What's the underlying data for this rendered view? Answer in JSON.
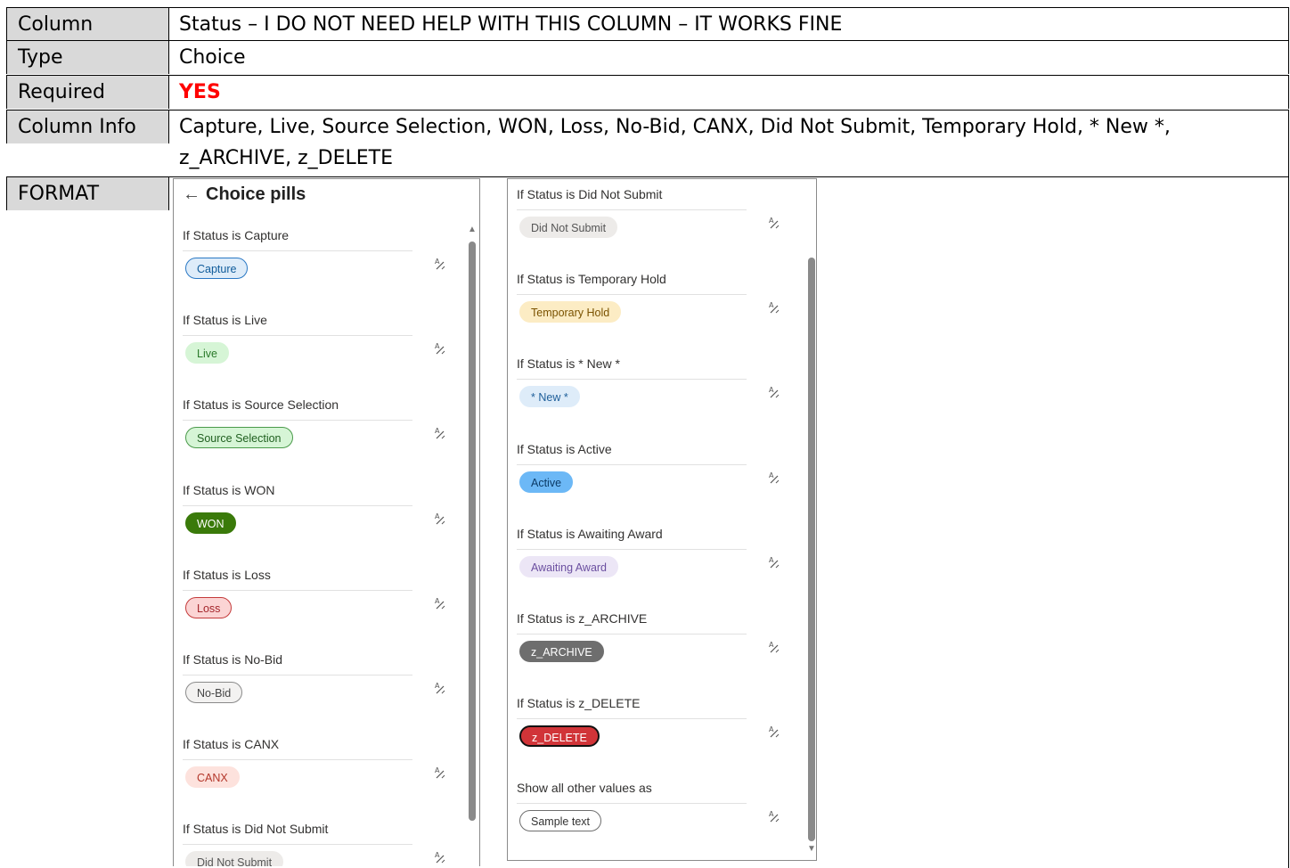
{
  "rows": {
    "column": {
      "label": "Column",
      "value": "Status – I DO NOT NEED HELP WITH THIS COLUMN – IT WORKS FINE"
    },
    "type": {
      "label": "Type",
      "value": "Choice"
    },
    "required": {
      "label": "Required",
      "value": "YES"
    },
    "info": {
      "label": "Column Info",
      "line1": "Capture, Live, Source Selection, WON, Loss, No-Bid, CANX, Did Not Submit, Temporary Hold, * New *,",
      "line2": "z_ARCHIVE, z_DELETE"
    },
    "format": {
      "label": "FORMAT"
    }
  },
  "colors": {
    "required": "#ff0000",
    "label_bg": "#d9d9d9"
  },
  "left_panel": {
    "title": "Choice pills",
    "back_icon": "arrow-left-icon",
    "rules": [
      {
        "caption": "If Status is Capture",
        "pill": "Capture",
        "bg": "#deecf9",
        "fg": "#0f5b9a",
        "border": "#2a78c4"
      },
      {
        "caption": "If Status is Live",
        "pill": "Live",
        "bg": "#d6f5d6",
        "fg": "#2a7a2a",
        "border": "#d6f5d6"
      },
      {
        "caption": "If Status is Source Selection",
        "pill": "Source Selection",
        "bg": "#d6f5d6",
        "fg": "#1f5f1f",
        "border": "#4a9a4a"
      },
      {
        "caption": "If Status is WON",
        "pill": "WON",
        "bg": "#3a7a0a",
        "fg": "#ffffff",
        "border": "#3a7a0a"
      },
      {
        "caption": "If Status is Loss",
        "pill": "Loss",
        "bg": "#fbd4d4",
        "fg": "#a4262c",
        "border": "#c43b3b"
      },
      {
        "caption": "If Status is No-Bid",
        "pill": "No-Bid",
        "bg": "#f3f2f1",
        "fg": "#444444",
        "border": "#8a8a8a"
      },
      {
        "caption": "If Status is CANX",
        "pill": "CANX",
        "bg": "#fde2dd",
        "fg": "#b3372a",
        "border": "#fde2dd"
      },
      {
        "caption": "If Status is Did Not Submit",
        "pill": "Did Not Submit",
        "bg": "#edebe9",
        "fg": "#555555",
        "border": "#edebe9"
      }
    ]
  },
  "right_panel": {
    "rules": [
      {
        "caption": "If Status is Did Not Submit",
        "pill": "Did Not Submit",
        "bg": "#edebe9",
        "fg": "#555555",
        "border": "#edebe9"
      },
      {
        "caption": "If Status is Temporary Hold",
        "pill": "Temporary Hold",
        "bg": "#fcecc4",
        "fg": "#7a5200",
        "border": "#fcecc4"
      },
      {
        "caption": "If Status is * New *",
        "pill": "* New *",
        "bg": "#deecf9",
        "fg": "#1f5f9a",
        "border": "#deecf9"
      },
      {
        "caption": "If Status is Active",
        "pill": "Active",
        "bg": "#6cb8f6",
        "fg": "#0b3a66",
        "border": "#6cb8f6"
      },
      {
        "caption": "If Status is Awaiting Award",
        "pill": "Awaiting Award",
        "bg": "#ece6f6",
        "fg": "#6b4fa0",
        "border": "#ece6f6"
      },
      {
        "caption": "If Status is z_ARCHIVE",
        "pill": "z_ARCHIVE",
        "bg": "#6e6e6e",
        "fg": "#ffffff",
        "border": "#6e6e6e"
      },
      {
        "caption": "If Status is z_DELETE",
        "pill": "z_DELETE",
        "bg": "#d13438",
        "fg": "#ffffff",
        "border": "#111111"
      },
      {
        "caption": "Show all other values as",
        "pill": "Sample text",
        "bg": "#ffffff",
        "fg": "#333333",
        "border": "#6e6e6e"
      }
    ]
  },
  "edit_icon": "text-style-edit-icon"
}
